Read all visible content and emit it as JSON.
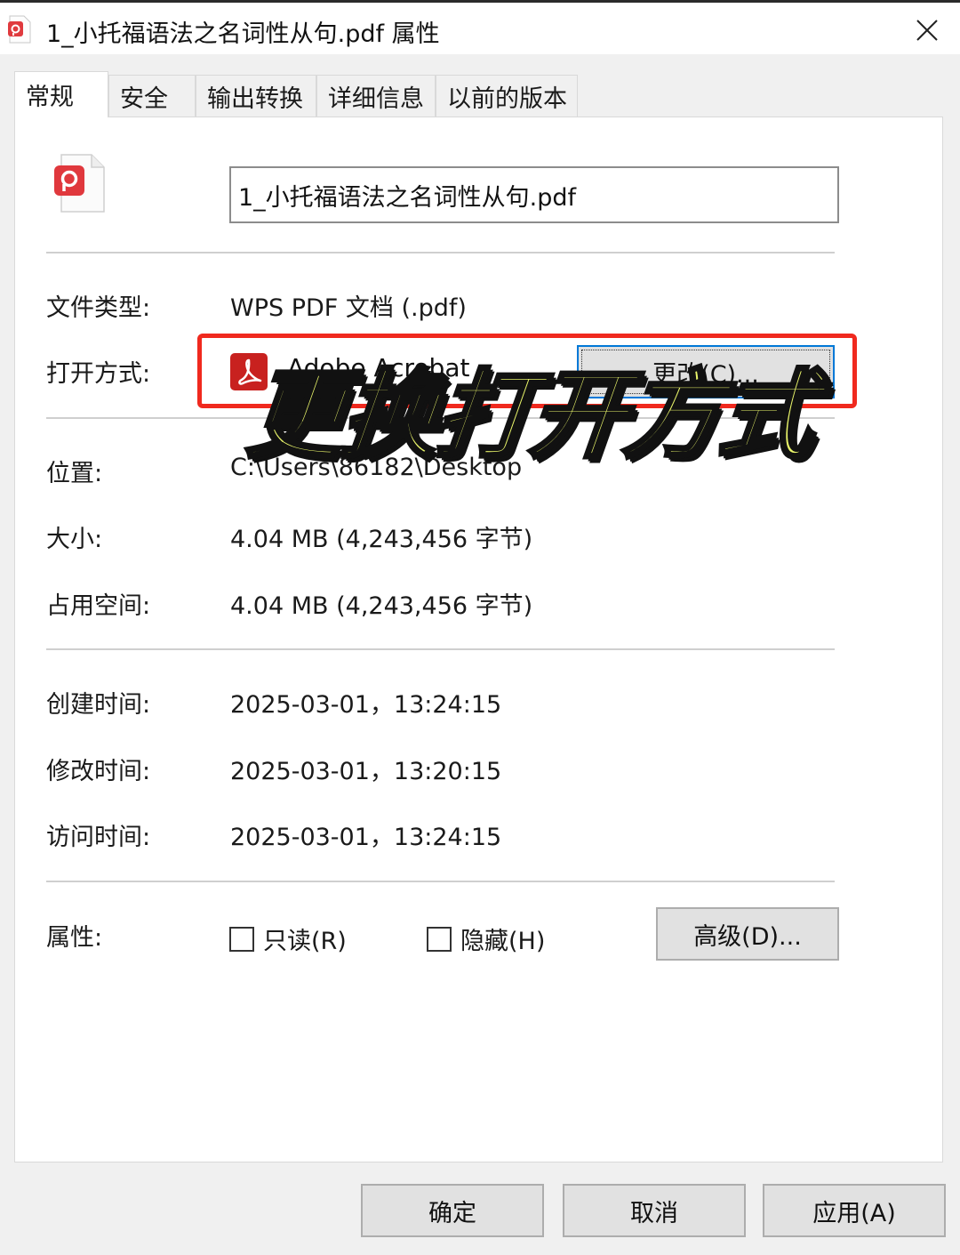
{
  "window": {
    "title": "1_小托福语法之名词性从句.pdf 属性"
  },
  "tabs": [
    {
      "label": "常规"
    },
    {
      "label": "安全"
    },
    {
      "label": "输出转换"
    },
    {
      "label": "详细信息"
    },
    {
      "label": "以前的版本"
    }
  ],
  "general": {
    "file_name": "1_小托福语法之名词性从句.pdf",
    "type_label": "文件类型:",
    "type_value": "WPS PDF 文档 (.pdf)",
    "open_with_label": "打开方式:",
    "open_with_app": "Adobe Acrobat",
    "change_button": "更改(C)...",
    "location_label": "位置:",
    "location_value": "C:\\Users\\86182\\Desktop",
    "size_label": "大小:",
    "size_value": "4.04 MB (4,243,456 字节)",
    "disk_size_label": "占用空间:",
    "disk_size_value": "4.04 MB (4,243,456 字节)",
    "created_label": "创建时间:",
    "created_value": "2025-03-01，13:24:15",
    "modified_label": "修改时间:",
    "modified_value": "2025-03-01，13:20:15",
    "accessed_label": "访问时间:",
    "accessed_value": "2025-03-01，13:24:15",
    "attributes_label": "属性:",
    "readonly_label": "只读(R)",
    "hidden_label": "隐藏(H)",
    "advanced_button": "高级(D)..."
  },
  "overlay_caption": "更换打开方式",
  "footer": {
    "ok": "确定",
    "cancel": "取消",
    "apply": "应用(A)"
  },
  "colors": {
    "highlight": "#f0291e",
    "overlay_fill": "#e9f56a",
    "focus_border": "#0078d7",
    "pdf_red": "#d0282b"
  }
}
